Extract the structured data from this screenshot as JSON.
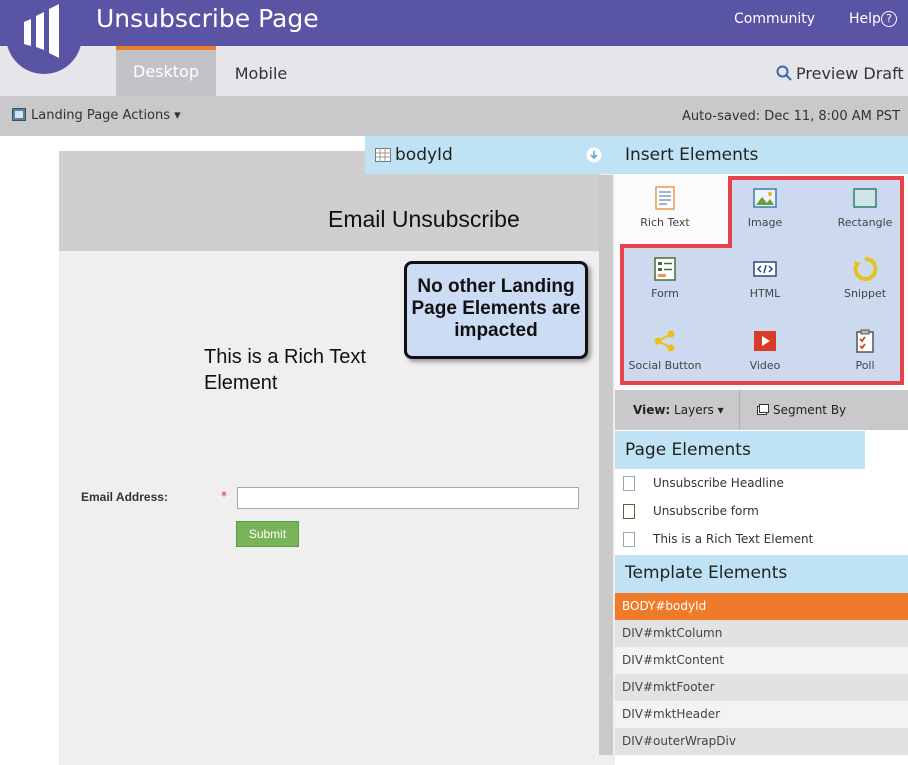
{
  "header": {
    "title": "Unsubscribe Page",
    "community": "Community",
    "help": "Help",
    "help_icon": "?"
  },
  "tabs": {
    "desktop": "Desktop",
    "mobile": "Mobile",
    "preview": "Preview Draft"
  },
  "actionbar": {
    "actions": "Landing Page Actions ▾",
    "autosave": "Auto-saved: Dec 11, 8:00 AM PST"
  },
  "canvas": {
    "selected": "bodyId",
    "headline": "Email Unsubscribe",
    "rich_text": "This is a Rich Text Element",
    "callout": "No other Landing Page Elements are impacted",
    "email_label": "Email Address:",
    "required": "*",
    "submit": "Submit"
  },
  "insert": {
    "title": "Insert Elements",
    "items": [
      {
        "label": "Rich Text",
        "icon": "rich-text-icon"
      },
      {
        "label": "Image",
        "icon": "image-icon"
      },
      {
        "label": "Rectangle",
        "icon": "rectangle-icon"
      },
      {
        "label": "Form",
        "icon": "form-icon"
      },
      {
        "label": "HTML",
        "icon": "html-icon"
      },
      {
        "label": "Snippet",
        "icon": "snippet-icon"
      },
      {
        "label": "Social Button",
        "icon": "social-button-icon"
      },
      {
        "label": "Video",
        "icon": "video-icon"
      },
      {
        "label": "Poll",
        "icon": "poll-icon"
      }
    ]
  },
  "view": {
    "view_prefix": "View:",
    "view_value": "Layers ▾",
    "segment": "Segment By"
  },
  "page_elements": {
    "title": "Page Elements",
    "items": [
      "Unsubscribe Headline",
      "Unsubscribe form",
      "This is a Rich Text Element"
    ]
  },
  "template_elements": {
    "title": "Template Elements",
    "items": [
      "BODY#bodyId",
      "DIV#mktColumn",
      "DIV#mktContent",
      "DIV#mktFooter",
      "DIV#mktHeader",
      "DIV#outerWrapDiv"
    ],
    "selected_color": "#ee7a2a"
  },
  "colors": {
    "brand": "#5a54a4",
    "accent": "#f07b2a",
    "highlight": "#e8434a"
  }
}
